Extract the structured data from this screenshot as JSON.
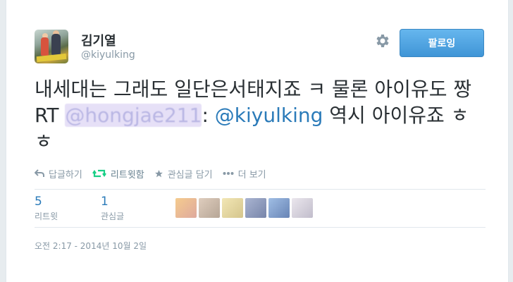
{
  "profile": {
    "name": "김기열",
    "handle": "@kiyulking"
  },
  "follow_button": {
    "label": "팔로잉"
  },
  "tweet": {
    "text_part1": "내세대는 그래도 일단은서태지죠 ㅋ 물론 아이유도 짱 RT ",
    "mention_blurred": "@hongjae211",
    "text_part2": ": ",
    "mention_visible": "@kiyulking",
    "text_part3": " 역시 아이유죠 ㅎㅎ"
  },
  "actions": {
    "reply": "답글하기",
    "retweet": "리트윗함",
    "favorite": "관심글 담기",
    "more": "더 보기"
  },
  "stats": {
    "retweets_count": "5",
    "retweets_label": "리트윗",
    "favorites_count": "1",
    "favorites_label": "관심글"
  },
  "timestamp": "오전 2:17 - 2014년 10월 2일",
  "colors": {
    "accent": "#2b7bb9",
    "retweet_green": "#19cf86",
    "follow_button": "#4a9ee0"
  }
}
